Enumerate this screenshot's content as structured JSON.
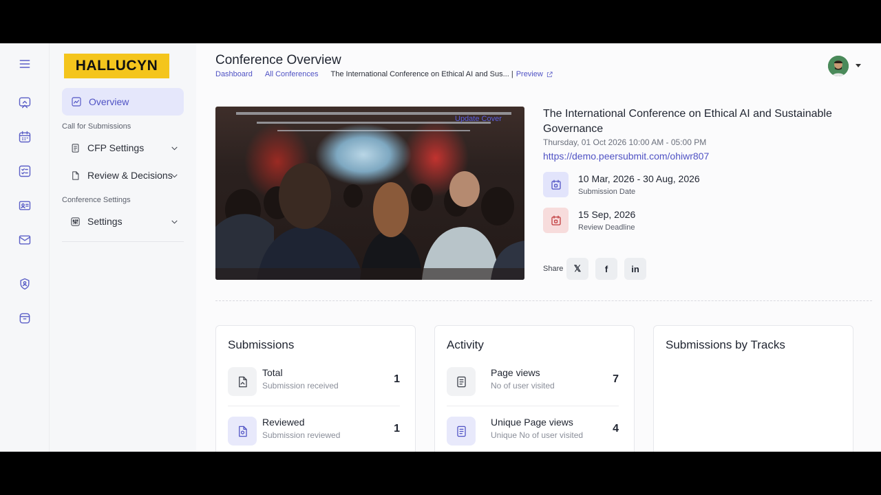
{
  "sidebar": {
    "logo": "HALLUCYN",
    "overview": "Overview",
    "section_cfs": "Call for Submissions",
    "cfp_settings": "CFP Settings",
    "review_decisions": "Review & Decisions",
    "section_conf": "Conference Settings",
    "settings": "Settings"
  },
  "header": {
    "title": "Conference Overview",
    "crumb_dashboard": "Dashboard",
    "crumb_all": "All Conferences",
    "crumb_current": "The International Conference on Ethical AI and Sus...",
    "crumb_sep": "|",
    "preview": "Preview"
  },
  "conference": {
    "cover_action": "Update Cover",
    "title": "The International Conference on Ethical AI and Sustainable Governance",
    "datetime": "Thursday, 01 Oct 2026 10:00 AM - 05:00 PM",
    "url": "https://demo.peersubmit.com/ohiwr807",
    "submission_range": "10 Mar, 2026 - 30 Aug, 2026",
    "submission_label": "Submission Date",
    "review_date": "15 Sep, 2026",
    "review_label": "Review Deadline",
    "share_label": "Share",
    "share_x": "𝕏",
    "share_fb": "f",
    "share_in": "in"
  },
  "submissions": {
    "title": "Submissions",
    "total_label": "Total",
    "total_sub": "Submission received",
    "total_value": "1",
    "reviewed_label": "Reviewed",
    "reviewed_sub": "Submission reviewed",
    "reviewed_value": "1"
  },
  "activity": {
    "title": "Activity",
    "views_label": "Page views",
    "views_sub": "No of user visited",
    "views_value": "7",
    "unique_label": "Unique Page views",
    "unique_sub": "Unique No of user visited",
    "unique_value": "4"
  },
  "tracks": {
    "title": "Submissions by Tracks"
  },
  "colors": {
    "accent": "#4f52c4",
    "logo_bg": "#f4c51d",
    "review_accent": "#c0393b"
  }
}
